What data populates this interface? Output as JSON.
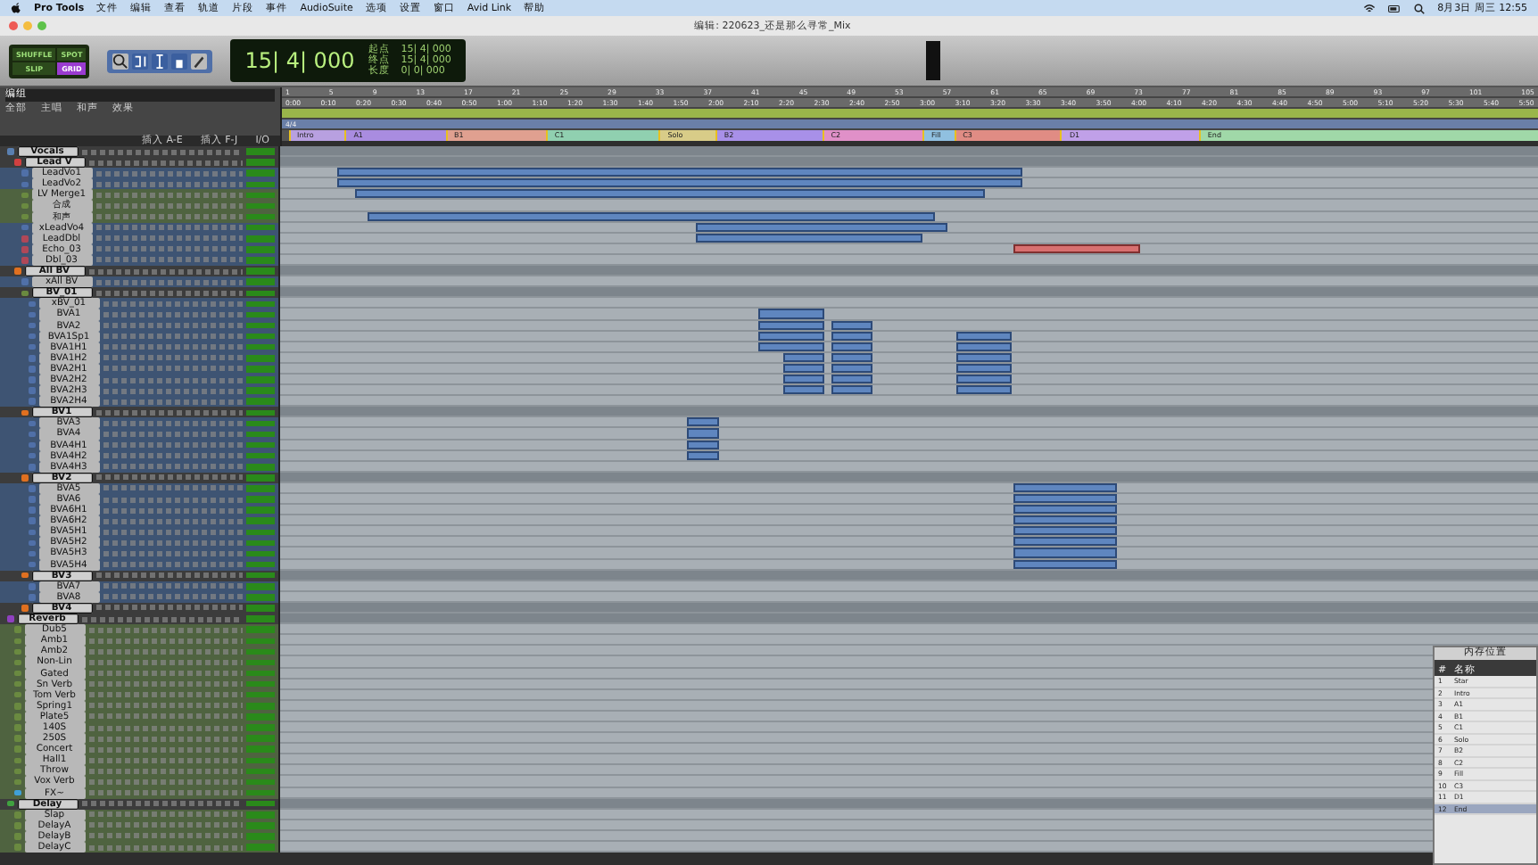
{
  "menu_bar": {
    "app": "Pro Tools",
    "items": [
      "文件",
      "编辑",
      "查看",
      "轨道",
      "片段",
      "事件",
      "AudioSuite",
      "选项",
      "设置",
      "窗口",
      "Avid Link",
      "帮助"
    ],
    "clock": "8月3日 周三 12:55"
  },
  "window": {
    "title": "编辑: 220623_还是那么寻常_Mix"
  },
  "toolbar": {
    "modes": [
      {
        "label": "SHUFFLE",
        "selected": false
      },
      {
        "label": "SPOT",
        "selected": false
      },
      {
        "label": "SLIP",
        "selected": false
      },
      {
        "label": "GRID",
        "selected": true
      }
    ],
    "counter": "15| 4| 000",
    "selection": [
      {
        "label": "起点",
        "value": "15| 4| 000"
      },
      {
        "label": "终点",
        "value": "15| 4| 000"
      },
      {
        "label": "长度",
        "value": "0| 0| 000"
      }
    ]
  },
  "groups_panel": {
    "title": "编组",
    "items": [
      "全部",
      "主唱",
      "和声",
      "效果"
    ]
  },
  "columns": [
    "插入 A-E",
    "插入 F-J",
    "I/O"
  ],
  "rulers": {
    "bars": [
      "1",
      "5",
      "9",
      "13",
      "17",
      "21",
      "25",
      "29",
      "33",
      "37",
      "41",
      "45",
      "49",
      "53",
      "57",
      "61",
      "65",
      "69",
      "73",
      "77",
      "81",
      "85",
      "89",
      "93",
      "97",
      "101",
      "105"
    ],
    "times": [
      "0:00",
      "0:10",
      "0:20",
      "0:30",
      "0:40",
      "0:50",
      "1:00",
      "1:10",
      "1:20",
      "1:30",
      "1:40",
      "1:50",
      "2:00",
      "2:10",
      "2:20",
      "2:30",
      "2:40",
      "2:50",
      "3:00",
      "3:10",
      "3:20",
      "3:30",
      "3:40",
      "3:50",
      "4:00",
      "4:10",
      "4:20",
      "4:30",
      "4:40",
      "4:50",
      "5:00",
      "5:10",
      "5:20",
      "5:30",
      "5:40",
      "5:50"
    ],
    "meter": "4/4"
  },
  "markers": [
    {
      "name": "Intro",
      "color": "#b8a0e0"
    },
    {
      "name": "A1",
      "color": "#a98ce0"
    },
    {
      "name": "B1",
      "color": "#e0a090"
    },
    {
      "name": "C1",
      "color": "#90d0b0"
    },
    {
      "name": "Solo",
      "color": "#d8cc88"
    },
    {
      "name": "B2",
      "color": "#a890e8"
    },
    {
      "name": "C2",
      "color": "#e090c8"
    },
    {
      "name": "Fill",
      "color": "#90c0e0"
    },
    {
      "name": "C3",
      "color": "#e08c84"
    },
    {
      "name": "D1",
      "color": "#c0a0e8"
    },
    {
      "name": "End",
      "color": "#a0d8a8"
    }
  ],
  "tracks": [
    {
      "name": "Vocals",
      "kind": "folder",
      "color": "#5a7fb0",
      "children": [
        {
          "name": "Lead V",
          "kind": "folder",
          "color": "#d04040",
          "children": [
            {
              "name": "LeadVo1",
              "kind": "audio",
              "color": "#5070a8"
            },
            {
              "name": "LeadVo2",
              "kind": "audio",
              "color": "#5070a8"
            },
            {
              "name": "LV Merge1",
              "kind": "aux",
              "color": "#6a8a40"
            },
            {
              "name": "合成",
              "kind": "aux",
              "color": "#6a8a40"
            },
            {
              "name": "和声",
              "kind": "aux",
              "color": "#6a8a40"
            },
            {
              "name": "xLeadVo4",
              "kind": "audio",
              "color": "#5070a8"
            },
            {
              "name": "LeadDbl",
              "kind": "audio",
              "color": "#b04858"
            },
            {
              "name": "Echo_03",
              "kind": "audio",
              "color": "#b04858"
            },
            {
              "name": "Dbl_03",
              "kind": "audio",
              "color": "#b04858"
            }
          ]
        },
        {
          "name": "All BV",
          "kind": "folder",
          "color": "#e07020",
          "children": [
            {
              "name": "xAll BV",
              "kind": "audio",
              "color": "#5070a8"
            },
            {
              "name": "BV_01",
              "kind": "folder",
              "color": "#6a8a40",
              "children": [
                {
                  "name": "xBV_01",
                  "kind": "audio",
                  "color": "#5070a8"
                },
                {
                  "name": "BVA1",
                  "kind": "audio",
                  "color": "#5070a8"
                },
                {
                  "name": "BVA2",
                  "kind": "audio",
                  "color": "#5070a8"
                },
                {
                  "name": "BVA1Sp1",
                  "kind": "audio",
                  "color": "#5070a8"
                },
                {
                  "name": "BVA1H1",
                  "kind": "audio",
                  "color": "#5070a8"
                },
                {
                  "name": "BVA1H2",
                  "kind": "audio",
                  "color": "#5070a8"
                },
                {
                  "name": "BVA2H1",
                  "kind": "audio",
                  "color": "#5070a8"
                },
                {
                  "name": "BVA2H2",
                  "kind": "audio",
                  "color": "#5070a8"
                },
                {
                  "name": "BVA2H3",
                  "kind": "audio",
                  "color": "#5070a8"
                },
                {
                  "name": "BVA2H4",
                  "kind": "audio",
                  "color": "#5070a8"
                }
              ]
            },
            {
              "name": "BV1",
              "kind": "folder",
              "color": "#e07020",
              "children": [
                {
                  "name": "BVA3",
                  "kind": "audio",
                  "color": "#5070a8"
                },
                {
                  "name": "BVA4",
                  "kind": "audio",
                  "color": "#5070a8"
                },
                {
                  "name": "BVA4H1",
                  "kind": "audio",
                  "color": "#5070a8"
                },
                {
                  "name": "BVA4H2",
                  "kind": "audio",
                  "color": "#5070a8"
                },
                {
                  "name": "BVA4H3",
                  "kind": "audio",
                  "color": "#5070a8"
                }
              ]
            },
            {
              "name": "BV2",
              "kind": "folder",
              "color": "#e07020",
              "children": [
                {
                  "name": "BVA5",
                  "kind": "audio",
                  "color": "#5070a8"
                },
                {
                  "name": "BVA6",
                  "kind": "audio",
                  "color": "#5070a8"
                },
                {
                  "name": "BVA6H1",
                  "kind": "audio",
                  "color": "#5070a8"
                },
                {
                  "name": "BVA6H2",
                  "kind": "audio",
                  "color": "#5070a8"
                },
                {
                  "name": "BVA5H1",
                  "kind": "audio",
                  "color": "#5070a8"
                },
                {
                  "name": "BVA5H2",
                  "kind": "audio",
                  "color": "#5070a8"
                },
                {
                  "name": "BVA5H3",
                  "kind": "audio",
                  "color": "#5070a8"
                },
                {
                  "name": "BVA5H4",
                  "kind": "audio",
                  "color": "#5070a8"
                }
              ]
            },
            {
              "name": "BV3",
              "kind": "folder",
              "color": "#e07020",
              "children": [
                {
                  "name": "BVA7",
                  "kind": "audio",
                  "color": "#5070a8"
                },
                {
                  "name": "BVA8",
                  "kind": "audio",
                  "color": "#5070a8"
                }
              ]
            },
            {
              "name": "BV4",
              "kind": "folder",
              "color": "#e07020"
            }
          ]
        }
      ]
    },
    {
      "name": "Reverb",
      "kind": "folder",
      "color": "#9040c0",
      "children": [
        {
          "name": "Dub5",
          "kind": "aux",
          "color": "#6a8a40"
        },
        {
          "name": "Amb1",
          "kind": "aux",
          "color": "#6a8a40"
        },
        {
          "name": "Amb2",
          "kind": "aux",
          "color": "#6a8a40"
        },
        {
          "name": "Non-Lin",
          "kind": "aux",
          "color": "#6a8a40"
        },
        {
          "name": "Gated",
          "kind": "aux",
          "color": "#6a8a40"
        },
        {
          "name": "Sn Verb",
          "kind": "aux",
          "color": "#6a8a40"
        },
        {
          "name": "Tom Verb",
          "kind": "aux",
          "color": "#6a8a40"
        },
        {
          "name": "Spring1",
          "kind": "aux",
          "color": "#6a8a40"
        },
        {
          "name": "Plate5",
          "kind": "aux",
          "color": "#6a8a40"
        },
        {
          "name": "140S",
          "kind": "aux",
          "color": "#6a8a40"
        },
        {
          "name": "250S",
          "kind": "aux",
          "color": "#6a8a40"
        },
        {
          "name": "Concert",
          "kind": "aux",
          "color": "#6a8a40"
        },
        {
          "name": "Hall1",
          "kind": "aux",
          "color": "#6a8a40"
        },
        {
          "name": "Throw",
          "kind": "aux",
          "color": "#6a8a40"
        },
        {
          "name": "Vox Verb",
          "kind": "aux",
          "color": "#6a8a40"
        },
        {
          "name": "FX~",
          "kind": "aux",
          "color": "#40a0d8"
        }
      ]
    },
    {
      "name": "Delay",
      "kind": "folder",
      "color": "#40a040",
      "children": [
        {
          "name": "Slap",
          "kind": "aux",
          "color": "#6a8a40"
        },
        {
          "name": "DelayA",
          "kind": "aux",
          "color": "#6a8a40"
        },
        {
          "name": "DelayB",
          "kind": "aux",
          "color": "#6a8a40"
        },
        {
          "name": "DelayC",
          "kind": "aux",
          "color": "#6a8a40"
        }
      ]
    }
  ],
  "memory_locations": {
    "title": "内存位置",
    "columns": [
      "#",
      "名称"
    ],
    "items": [
      {
        "number": "1",
        "name": "Star",
        "selected": false
      },
      {
        "number": "2",
        "name": "Intro",
        "selected": false
      },
      {
        "number": "3",
        "name": "A1",
        "selected": false
      },
      {
        "number": "4",
        "name": "B1",
        "selected": false
      },
      {
        "number": "5",
        "name": "C1",
        "selected": false
      },
      {
        "number": "6",
        "name": "Solo",
        "selected": false
      },
      {
        "number": "7",
        "name": "B2",
        "selected": false
      },
      {
        "number": "8",
        "name": "C2",
        "selected": false
      },
      {
        "number": "9",
        "name": "Fill",
        "selected": false
      },
      {
        "number": "10",
        "name": "C3",
        "selected": false
      },
      {
        "number": "11",
        "name": "D1",
        "selected": false
      },
      {
        "number": "12",
        "name": "End",
        "selected": true
      }
    ]
  }
}
